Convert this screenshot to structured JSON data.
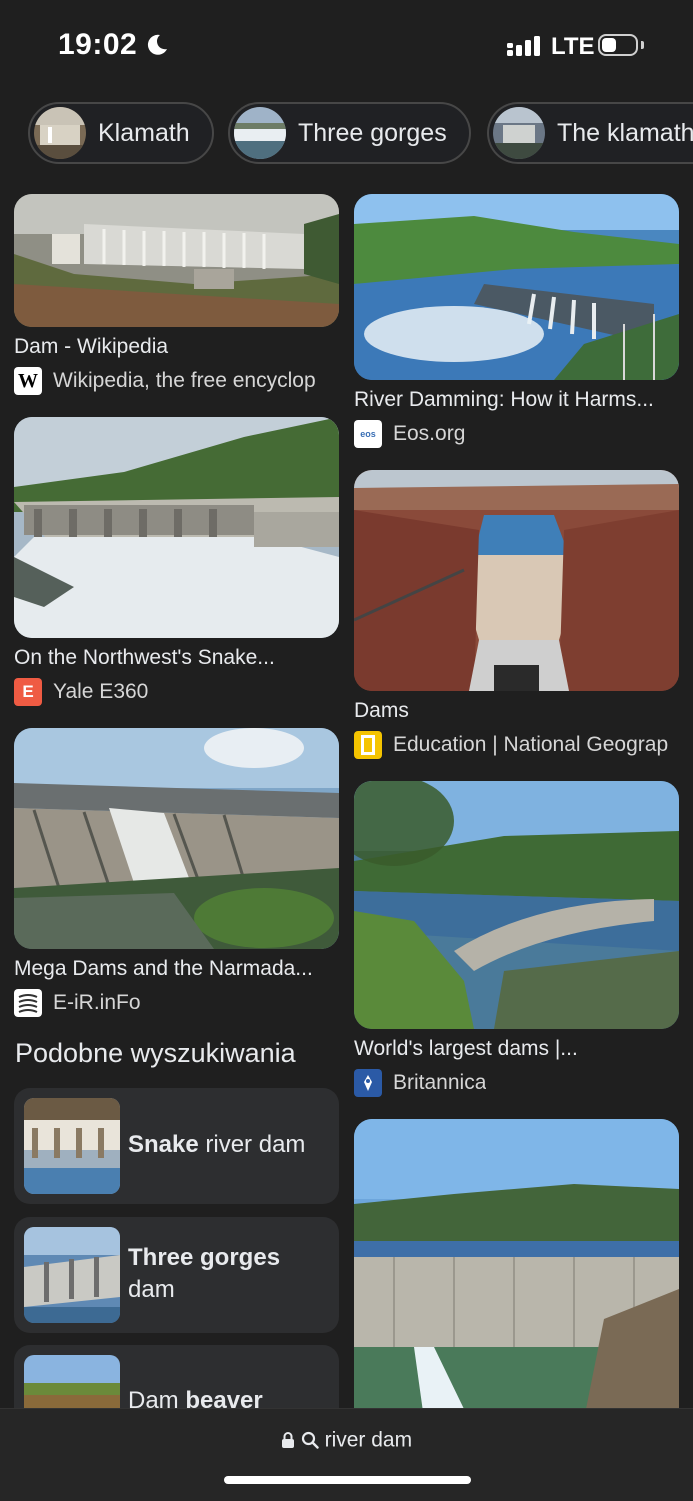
{
  "status_bar": {
    "time": "19:02",
    "network": "LTE",
    "battery_level": 0.45
  },
  "chips": [
    {
      "label": "Klamath"
    },
    {
      "label": "Three gorges"
    },
    {
      "label": "The klamath"
    }
  ],
  "results": [
    {
      "title": "Dam - Wikipedia",
      "source": "Wikipedia, the free encyclop",
      "favicon": "wikipedia-icon"
    },
    {
      "title": "River Damming: How it Harms...",
      "source": "Eos.org",
      "favicon": "eos-icon"
    },
    {
      "title": "On the Northwest's Snake...",
      "source": "Yale E360",
      "favicon": "yale-e360-icon",
      "favicon_letter": "E"
    },
    {
      "title": "Dams",
      "source": "Education | National Geograp",
      "favicon": "natgeo-icon"
    },
    {
      "title": "Mega Dams and the Narmada...",
      "source": "E-iR.inFo",
      "favicon": "eir-icon"
    },
    {
      "title": "World's largest dams |...",
      "source": "Britannica",
      "favicon": "britannica-icon"
    }
  ],
  "related": {
    "heading": "Podobne wyszukiwania",
    "items": [
      {
        "bold": "Snake",
        "rest": " river dam"
      },
      {
        "bold": "Three gorges",
        "rest": "dam"
      },
      {
        "bold": "beaver",
        "pre": "Dam "
      }
    ]
  },
  "address_bar": {
    "text": "river dam"
  },
  "colors": {
    "background": "#1f1f1f",
    "card": "#2d2e30",
    "yale": "#ef5b43",
    "natgeo": "#f5c400"
  }
}
